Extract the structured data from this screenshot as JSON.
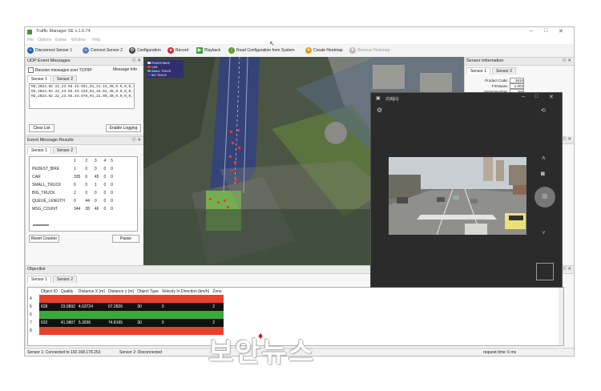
{
  "app": {
    "title": "Traffic Manager SE v.1.0.74",
    "menu": [
      "File",
      "Options",
      "Extras",
      "Window",
      "Help"
    ]
  },
  "toolbar": {
    "disconnect1": "Disconnect Sensor 1",
    "connect2": "Connect Sensor 2",
    "configuration": "Configuration",
    "record": "Record",
    "playback": "Playback",
    "read_config": "Read Configuration from System",
    "create_heatmap": "Create Heatmap",
    "remove_heatmap": "Remove Heatmap"
  },
  "udp_panel": {
    "title": "UDP Event Messages",
    "checkbox_label": "Receive messages over TCP/IP",
    "message_info": "Message Info",
    "tabs": [
      "Sensor 1",
      "Sensor 2"
    ],
    "log_lines": [
      "MZ,2024.02.22_23.56.42.031,01,21.15,30,0.0,0,0,762;",
      "MZ,2024.02.22_23.56.43.129,01,26.01,30,0.0,0,0,763;",
      "MZ,2024.02.22_23.56.44.978,01,22.00,30,0.0,0,0,764;"
    ],
    "clear_list": "Clear List",
    "enable_logging": "Enable Logging"
  },
  "event_results": {
    "title": "Event Message Results",
    "tabs": [
      "Sensor 1",
      "Sensor 2"
    ],
    "columns": [
      "",
      "1",
      "2",
      "3",
      "4",
      "5"
    ],
    "rows": [
      [
        "PEDEST_BIKE",
        "1",
        "0",
        "0",
        "0",
        "0"
      ],
      [
        "CAR",
        "335",
        "6",
        "45",
        "0",
        "0"
      ],
      [
        "SMALL_TRUCK",
        "6",
        "0",
        "1",
        "0",
        "0"
      ],
      [
        "BIG_TRUCK",
        "2",
        "0",
        "0",
        "0",
        "0"
      ],
      [
        "QUEUE_LENGTH",
        "0",
        "44",
        "0",
        "0",
        "0"
      ],
      [
        "MSG_COUNT",
        "344",
        "28",
        "46",
        "0",
        "0"
      ]
    ],
    "reset_counter": "Reset Counter",
    "pause": "Pause"
  },
  "sensor_info": {
    "title": "Sensor Information",
    "tabs": [
      "Sensor 1",
      "Sensor 2"
    ],
    "fields": [
      {
        "label": "Product Code:",
        "value": "3810"
      },
      {
        "label": "Firmware:",
        "value": "1.002"
      },
      {
        "label": "Serial Number:",
        "value": "356"
      }
    ]
  },
  "map": {
    "legend": [
      "PEDEST/BIKE",
      "CAR",
      "SMALL TRUCK",
      "BIG TRUCK"
    ],
    "legend_colors": [
      "#d8d8d8",
      "#ff3333",
      "#33cc33",
      "#3333ff"
    ]
  },
  "camera": {
    "title": "카메라"
  },
  "objectlist": {
    "title": "Objectlist",
    "tabs": [
      "Sensor 1",
      "Sensor 2"
    ],
    "columns": [
      "",
      "Object ID",
      "Quality",
      "Distance X (m)",
      "Distance y (m)",
      "Object Type",
      "Velocity In Direction (km/h)",
      "Zone"
    ],
    "rows": [
      {
        "cells": [
          "4",
          "",
          "",
          "",
          "",
          "",
          "",
          ""
        ],
        "color": "#e8412b"
      },
      {
        "cells": [
          "5",
          "628",
          "23.0892",
          "4.63724",
          "67.2826",
          "30",
          "0",
          "2"
        ],
        "color": "#111111"
      },
      {
        "cells": [
          "6",
          "",
          "",
          "",
          "",
          "",
          "",
          ""
        ],
        "color": "#3aa83a"
      },
      {
        "cells": [
          "7",
          "632",
          "41.0807",
          "5.3936",
          "74.8165",
          "30",
          "0",
          "2"
        ],
        "color": "#111111"
      },
      {
        "cells": [
          "8",
          "",
          "",
          "",
          "",
          "",
          "",
          ""
        ],
        "color": "#e8412b"
      }
    ]
  },
  "status": {
    "sensor1": "Sensor 1: Connected to 192.168.178.253",
    "sensor2": "Sensor 2: Disconnected",
    "request": "request time: 6 ms"
  },
  "watermark": "보안뉴스"
}
